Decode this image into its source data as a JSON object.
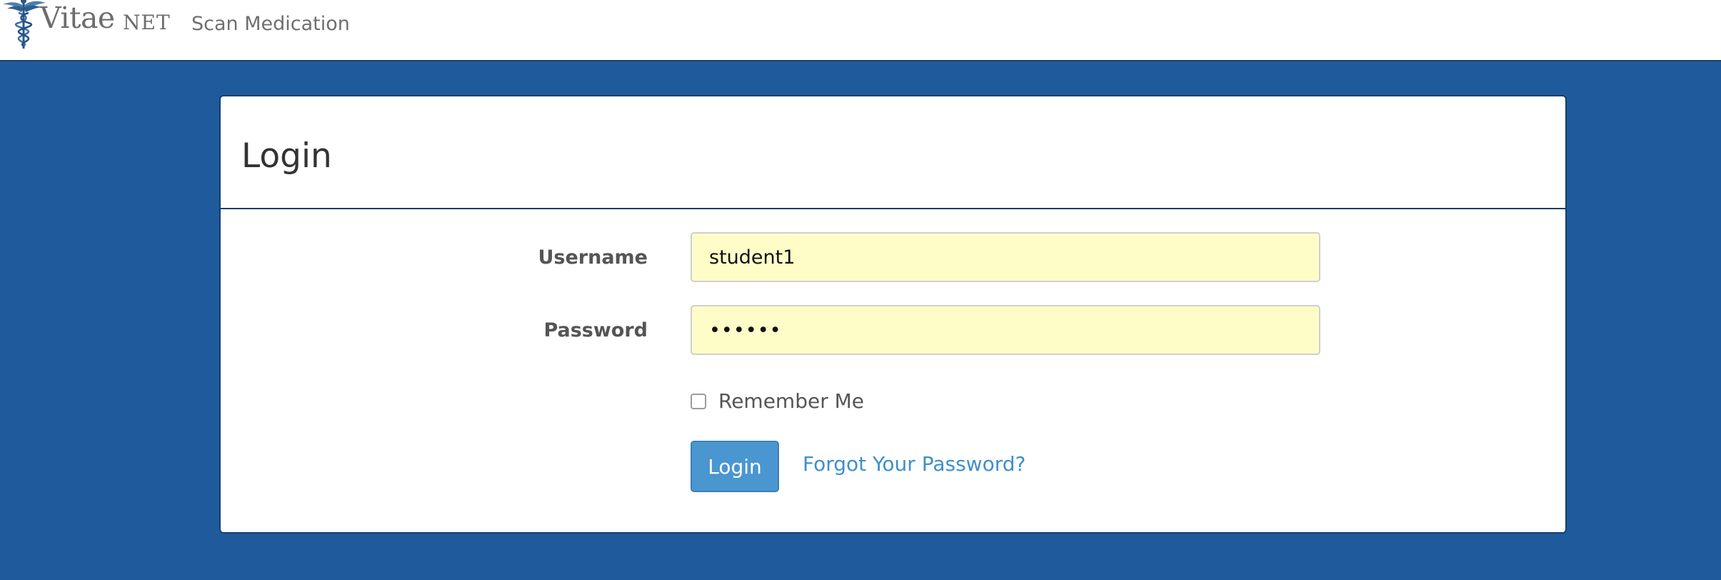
{
  "navbar": {
    "brand_name": "Vitae",
    "brand_suffix": "NET",
    "brand_logo_icon": "caduceus-icon",
    "links": [
      {
        "label": "Scan Medication"
      }
    ]
  },
  "login_panel": {
    "title": "Login",
    "username": {
      "label": "Username",
      "value": "student1"
    },
    "password": {
      "label": "Password",
      "value": "••••••"
    },
    "remember_me": {
      "label": "Remember Me",
      "checked": false
    },
    "submit_label": "Login",
    "forgot_password_label": "Forgot Your Password?"
  },
  "colors": {
    "page_background": "#1f5b9c",
    "input_autofill": "#fefdc8",
    "button_primary": "#4a96d0",
    "link": "#3f8fcb"
  }
}
